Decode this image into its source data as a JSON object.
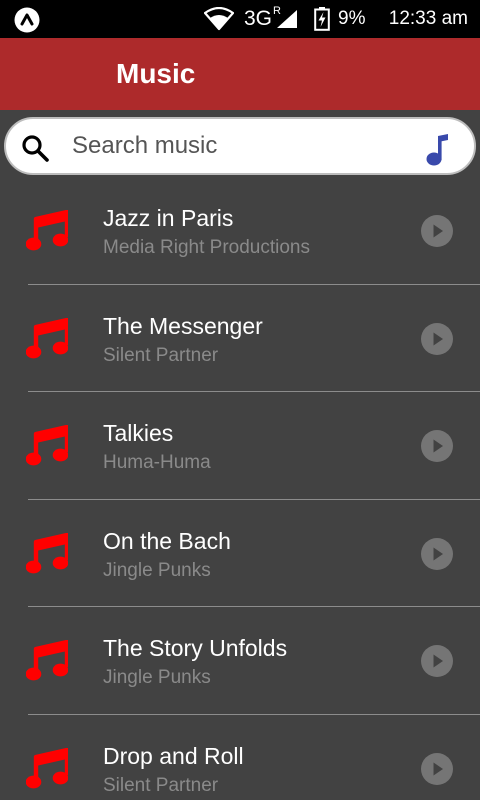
{
  "status_bar": {
    "network_type": "3G",
    "network_superscript": "R",
    "battery_percent": "9%",
    "time": "12:33 am",
    "icons": [
      "app-badge-icon",
      "wifi-icon",
      "signal-icon",
      "battery-charging-icon"
    ]
  },
  "app_bar": {
    "title": "Music"
  },
  "search": {
    "placeholder": "Search music",
    "value": "",
    "icons": [
      "search-icon",
      "music-note-icon"
    ]
  },
  "colors": {
    "app_bar": "#ad2a2b",
    "background": "#424242",
    "note_icon": "#ff0000",
    "voice_note_icon": "#3949ab",
    "secondary_text": "#8a8a8a"
  },
  "tracks": [
    {
      "title": "Jazz in Paris",
      "artist": "Media Right Productions"
    },
    {
      "title": "The Messenger",
      "artist": "Silent Partner"
    },
    {
      "title": "Talkies",
      "artist": "Huma-Huma"
    },
    {
      "title": "On the Bach",
      "artist": "Jingle Punks"
    },
    {
      "title": "The Story Unfolds",
      "artist": "Jingle Punks"
    },
    {
      "title": "Drop and Roll",
      "artist": "Silent Partner"
    }
  ]
}
